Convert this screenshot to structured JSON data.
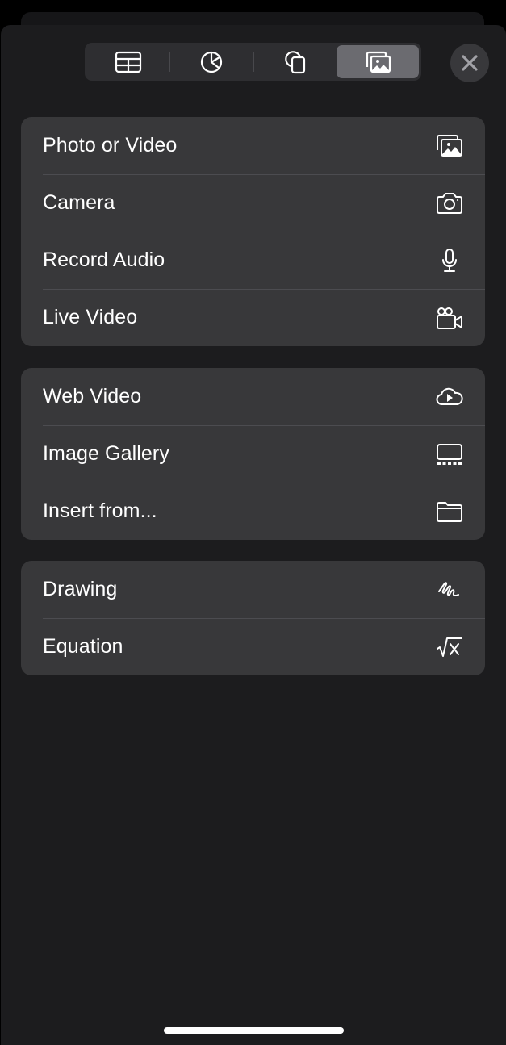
{
  "toolbar": {
    "tabs": [
      {
        "id": "table",
        "icon": "table-icon",
        "active": false
      },
      {
        "id": "chart",
        "icon": "pie-chart-icon",
        "active": false
      },
      {
        "id": "shape",
        "icon": "shapes-icon",
        "active": false
      },
      {
        "id": "media",
        "icon": "photos-icon",
        "active": true
      }
    ],
    "close_icon": "close-icon"
  },
  "groups": [
    {
      "items": [
        {
          "label": "Photo or Video",
          "icon": "photos-icon"
        },
        {
          "label": "Camera",
          "icon": "camera-icon"
        },
        {
          "label": "Record Audio",
          "icon": "microphone-icon"
        },
        {
          "label": "Live Video",
          "icon": "video-camera-icon"
        }
      ]
    },
    {
      "items": [
        {
          "label": "Web Video",
          "icon": "cloud-play-icon"
        },
        {
          "label": "Image Gallery",
          "icon": "image-gallery-icon"
        },
        {
          "label": "Insert from...",
          "icon": "folder-icon"
        }
      ]
    },
    {
      "items": [
        {
          "label": "Drawing",
          "icon": "scribble-icon"
        },
        {
          "label": "Equation",
          "icon": "square-root-x-icon"
        }
      ]
    }
  ],
  "colors": {
    "sheet_background": "#1c1c1e",
    "group_background": "#38383a",
    "active_segment": "#6b6b70",
    "text": "#ffffff"
  }
}
